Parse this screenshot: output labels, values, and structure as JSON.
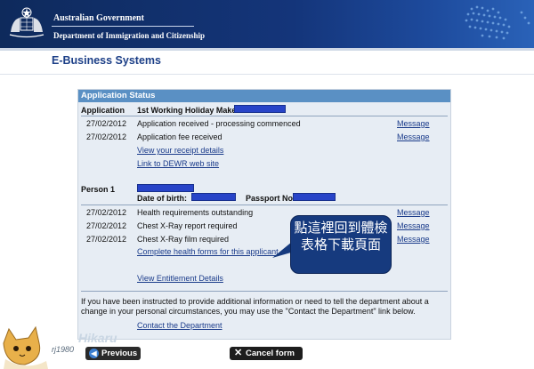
{
  "header": {
    "gov_name": "Australian Government",
    "department": "Department of Immigration and Citizenship",
    "crest_icon": "coat-of-arms-icon",
    "map_icon": "australia-dot-map-icon"
  },
  "page": {
    "title": "E-Business Systems"
  },
  "status": {
    "heading": "Application Status",
    "application_label": "Application",
    "application_name": "1st Working Holiday Maker -",
    "events": [
      {
        "date": "27/02/2012",
        "text": "Application received - processing commenced",
        "action": "Message"
      },
      {
        "date": "27/02/2012",
        "text": "Application fee received",
        "action": "Message"
      }
    ],
    "links": {
      "receipt": "View your receipt details",
      "dewr": "Link to DEWR web site"
    }
  },
  "person": {
    "label": "Person 1",
    "dob_label": "Date of birth:",
    "passport_label": "Passport No:",
    "events": [
      {
        "date": "27/02/2012",
        "text": "Health requirements outstanding",
        "action": "Message"
      },
      {
        "date": "27/02/2012",
        "text": "Chest X-Ray report required",
        "action": "Message"
      },
      {
        "date": "27/02/2012",
        "text": "Chest X-Ray film required",
        "action": "Message"
      }
    ],
    "links": {
      "health_forms": "Complete health forms for this applicant",
      "entitlement": "View Entitlement Details"
    }
  },
  "callout": {
    "text": "點這裡回到體檢表格下載頁面"
  },
  "footer": {
    "info": "If you have been instructed to provide additional information or need to tell the department about a change in your personal circumstances, you may use the \"Contact the Department\" link below.",
    "contact_link": "Contact the Department"
  },
  "buttons": {
    "previous": "Previous",
    "cancel": "Cancel form"
  },
  "watermark": {
    "handle": "rj1980",
    "brand": "Hikaru"
  },
  "colors": {
    "header_bg": "#14357a",
    "panel_head": "#5a90c4",
    "panel_bg": "#e7edf4",
    "link": "#1a3b8a",
    "redaction": "#2844c8",
    "callout_bg": "#163a7e"
  }
}
